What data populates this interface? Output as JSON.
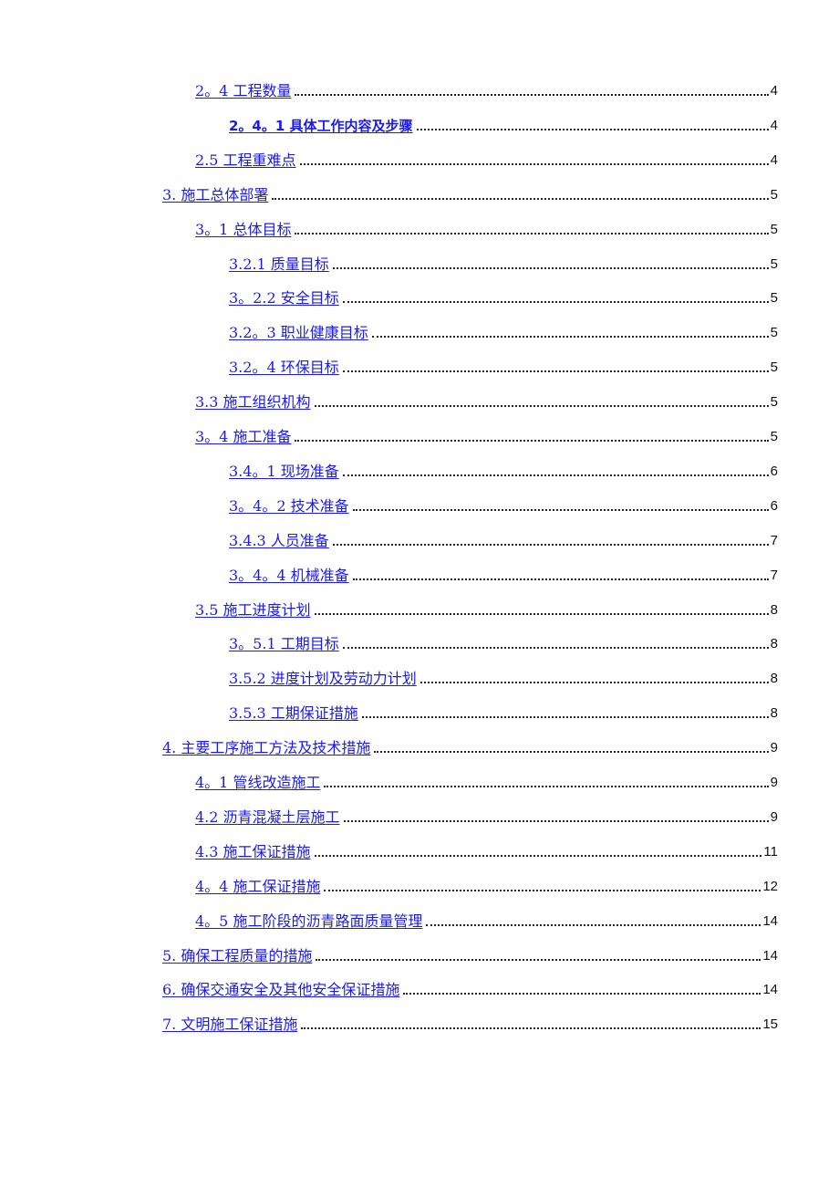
{
  "toc": {
    "entries": [
      {
        "level": 2,
        "title": "2。4 工程数量",
        "page": "4",
        "bold": false
      },
      {
        "level": 3,
        "title": "2。4。1 具体工作内容及步骤",
        "page": "4",
        "bold": true
      },
      {
        "level": 2,
        "title": "2.5 工程重难点",
        "page": "4",
        "bold": false
      },
      {
        "level": 1,
        "title": "3. 施工总体部署",
        "page": "5",
        "bold": false
      },
      {
        "level": 2,
        "title": "3。1 总体目标",
        "page": "5",
        "bold": false
      },
      {
        "level": 3,
        "title": "3.2.1 质量目标",
        "page": "5",
        "bold": false
      },
      {
        "level": 3,
        "title": "3。2.2 安全目标",
        "page": "5",
        "bold": false
      },
      {
        "level": 3,
        "title": "3.2。3 职业健康目标",
        "page": "5",
        "bold": false
      },
      {
        "level": 3,
        "title": "3.2。4 环保目标",
        "page": "5",
        "bold": false
      },
      {
        "level": 2,
        "title": "3.3 施工组织机构",
        "page": "5",
        "bold": false
      },
      {
        "level": 2,
        "title": "3。4 施工准备",
        "page": "5",
        "bold": false
      },
      {
        "level": 3,
        "title": "3.4。1 现场准备",
        "page": "6",
        "bold": false
      },
      {
        "level": 3,
        "title": "3。4。2 技术准备",
        "page": "6",
        "bold": false
      },
      {
        "level": 3,
        "title": "3.4.3 人员准备",
        "page": "7",
        "bold": false
      },
      {
        "level": 3,
        "title": "3。4。4 机械准备",
        "page": "7",
        "bold": false
      },
      {
        "level": 2,
        "title": "3.5 施工进度计划",
        "page": "8",
        "bold": false
      },
      {
        "level": 3,
        "title": "3。5.1 工期目标",
        "page": "8",
        "bold": false
      },
      {
        "level": 3,
        "title": "3.5.2 进度计划及劳动力计划",
        "page": "8",
        "bold": false
      },
      {
        "level": 3,
        "title": "3.5.3 工期保证措施",
        "page": "8",
        "bold": false
      },
      {
        "level": 1,
        "title": "4. 主要工序施工方法及技术措施",
        "page": "9",
        "bold": false
      },
      {
        "level": 2,
        "title": "4。1 管线改造施工",
        "page": "9",
        "bold": false
      },
      {
        "level": 2,
        "title": "4.2 沥青混凝土层施工",
        "page": "9",
        "bold": false
      },
      {
        "level": 2,
        "title": "4.3 施工保证措施",
        "page": "11",
        "bold": false
      },
      {
        "level": 2,
        "title": "4。4 施工保证措施",
        "page": "12",
        "bold": false
      },
      {
        "level": 2,
        "title": "4。5 施工阶段的沥青路面质量管理",
        "page": "14",
        "bold": false
      },
      {
        "level": 1,
        "title": "5. 确保工程质量的措施",
        "page": "14",
        "bold": false
      },
      {
        "level": 1,
        "title": "6. 确保交通安全及其他安全保证措施",
        "page": "14",
        "bold": false
      },
      {
        "level": 1,
        "title": "7. 文明施工保证措施",
        "page": "15",
        "bold": false
      }
    ]
  },
  "colors": {
    "link": "#1a1aee",
    "text": "#111111"
  }
}
